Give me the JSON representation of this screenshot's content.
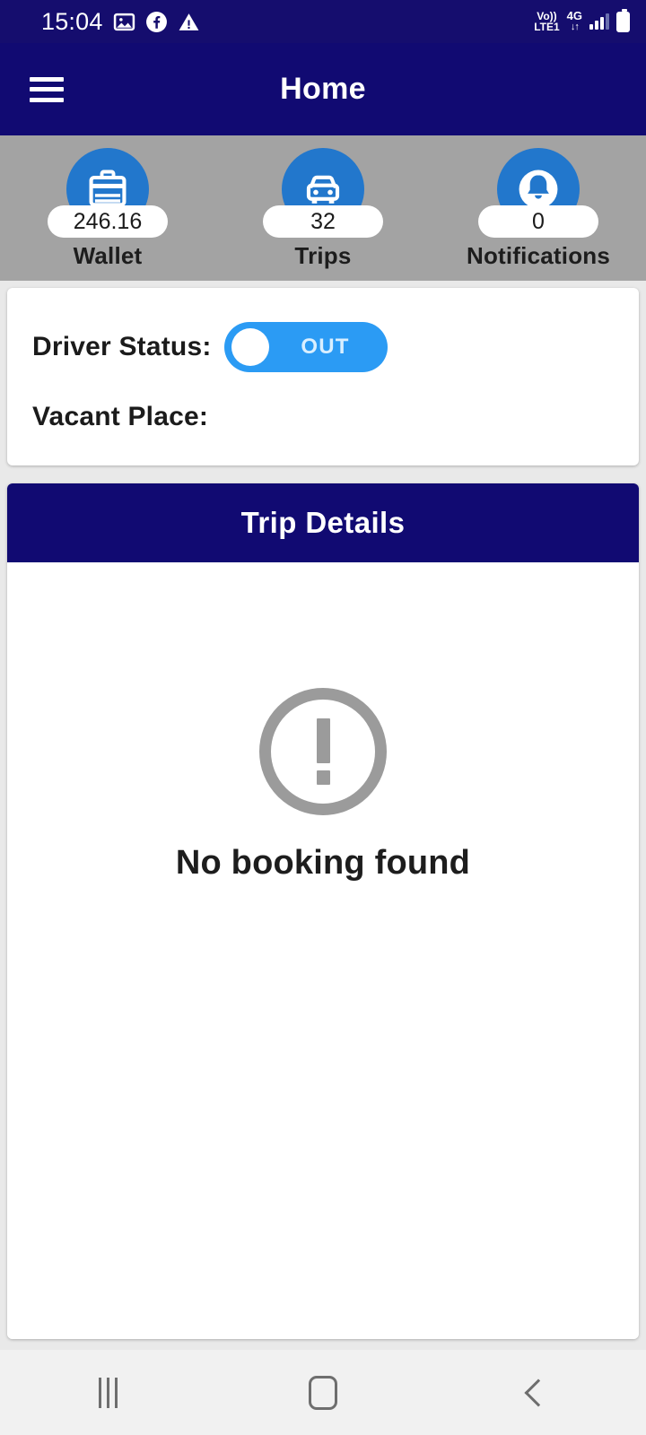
{
  "status_bar": {
    "time": "15:04",
    "icons_left": [
      "image-icon",
      "facebook-icon",
      "warning-triangle-icon"
    ],
    "volte_top": "Vo))",
    "volte_bottom": "LTE1",
    "network": "4G",
    "network_arrows": "↓↑",
    "icons_right": [
      "signal-bars-icon",
      "battery-icon"
    ]
  },
  "appbar": {
    "title": "Home",
    "menu_icon": "hamburger-menu-icon",
    "background": "#110a72"
  },
  "stats": {
    "background": "#a3a3a3",
    "accent": "#2277cc",
    "items": [
      {
        "icon": "briefcase-icon",
        "value": "246.16",
        "label": "Wallet"
      },
      {
        "icon": "car-icon",
        "value": "32",
        "label": "Trips"
      },
      {
        "icon": "bell-icon",
        "value": "0",
        "label": "Notifications"
      }
    ]
  },
  "driver_card": {
    "status_label": "Driver Status:",
    "toggle_text": "OUT",
    "toggle_on": false,
    "toggle_color": "#2b9bf4",
    "vacant_label": "Vacant Place:",
    "vacant_value": ""
  },
  "trip_card": {
    "header": "Trip Details",
    "header_color": "#110a72",
    "empty_icon": "exclamation-circle-icon",
    "empty_text": "No booking found"
  },
  "navbar": {
    "recents": "recents-icon",
    "home": "home-icon",
    "back": "back-icon"
  }
}
